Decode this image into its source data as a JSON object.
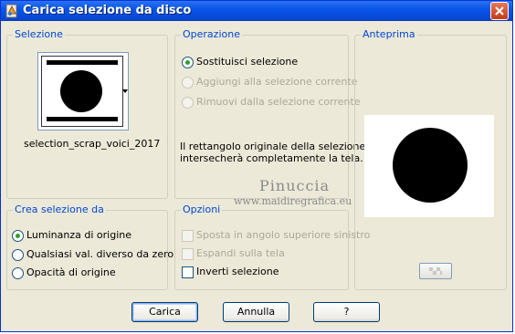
{
  "window": {
    "title": "Carica selezione da disco"
  },
  "selezione": {
    "legend": "Selezione",
    "filename": "selection_scrap_voici_2017"
  },
  "operazione": {
    "legend": "Operazione",
    "options": [
      {
        "label": "Sostituisci selezione",
        "checked": true,
        "enabled": true
      },
      {
        "label": "Aggiungi alla selezione corrente",
        "checked": false,
        "enabled": false
      },
      {
        "label": "Rimuovi dalla selezione corrente",
        "checked": false,
        "enabled": false
      }
    ],
    "message_line1": "Il rettangolo originale della selezione",
    "message_line2": "intersecherà completamente la tela."
  },
  "anteprima": {
    "legend": "Anteprima"
  },
  "crea": {
    "legend": "Crea selezione da",
    "options": [
      {
        "label": "Luminanza di origine",
        "checked": true
      },
      {
        "label": "Qualsiasi val. diverso da zero",
        "checked": false
      },
      {
        "label": "Opacità di origine",
        "checked": false
      }
    ]
  },
  "opzioni": {
    "legend": "Opzioni",
    "items": [
      {
        "label": "Sposta in angolo superiore sinistro",
        "checked": false,
        "enabled": false
      },
      {
        "label": "Espandi sulla tela",
        "checked": false,
        "enabled": false
      },
      {
        "label": "Inverti selezione",
        "checked": false,
        "enabled": true
      }
    ]
  },
  "buttons": {
    "carica": "Carica",
    "annulla": "Annulla",
    "help": "?"
  },
  "watermark": {
    "name": "Pinuccia",
    "site": "www.maidiregrafica.eu"
  },
  "colors": {
    "titlebar": "#0a55e8",
    "legend": "#0046d5",
    "face": "#ece9d8",
    "radio_dot": "#2da02d"
  }
}
